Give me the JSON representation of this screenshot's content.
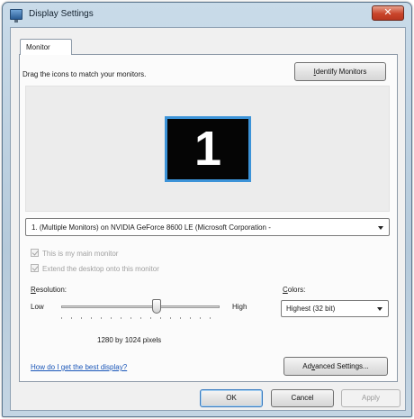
{
  "window": {
    "title": "Display Settings",
    "close_glyph": "✕"
  },
  "tabs": [
    {
      "label": "Monitor",
      "selected": true
    }
  ],
  "monitor_tab": {
    "instruction": "Drag the icons to match your monitors.",
    "identify_button": {
      "mnemonic": "I",
      "rest": "dentify Monitors"
    },
    "monitor_number": "1",
    "display_select_value": "1. (Multiple Monitors) on NVIDIA GeForce 8600 LE (Microsoft Corporation -",
    "main_monitor_checkbox": {
      "label": "This is my main monitor",
      "checked": true,
      "enabled": false
    },
    "extend_checkbox": {
      "label": "Extend the desktop onto this monitor",
      "checked": true,
      "enabled": false
    },
    "resolution": {
      "label_mnemonic": "R",
      "label_rest": "esolution:",
      "low_label": "Low",
      "high_label": "High",
      "value_text": "1280 by 1024 pixels",
      "slider_level": 0.6
    },
    "colors": {
      "label_mnemonic": "C",
      "label_rest": "olors:",
      "selected": "Highest (32 bit)"
    },
    "help_link": "How do I get the best display?",
    "advanced_button": {
      "before": "Ad",
      "mnemonic": "v",
      "after": "anced Settings..."
    }
  },
  "footer": {
    "ok": "OK",
    "cancel": "Cancel",
    "apply": "Apply"
  },
  "colors": {
    "monitor_border": "#3c93d8",
    "close_button": "#c9452b",
    "link": "#1a56b8"
  }
}
